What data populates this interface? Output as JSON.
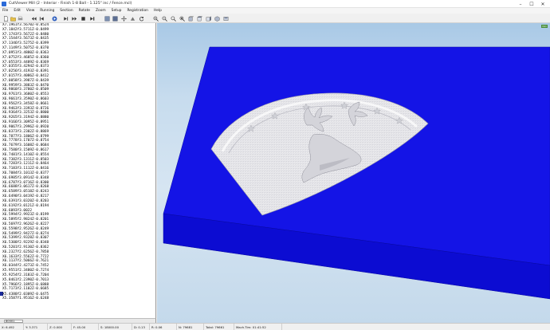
{
  "window": {
    "title": "CutViewer Mill (2 - Interior - Finish 1-8 Ball - 1.125\" inc / Fence.mcl)",
    "controls": {
      "minimize": "–",
      "maximize": "☐",
      "close": "✕"
    }
  },
  "menu": [
    "File",
    "Edit",
    "View",
    "Running",
    "Section",
    "Rotate",
    "Zoom",
    "Setup",
    "Registration",
    "Help"
  ],
  "toolbar": {
    "icons": [
      "new-file-icon",
      "open-folder-icon",
      "print-icon",
      "rewind-icon",
      "step-back-icon",
      "play-icon",
      "step-forward-icon",
      "fast-forward-icon",
      "stop-icon",
      "end-icon",
      "stock-icon",
      "tool-icon",
      "move-icon",
      "section-icon",
      "rotate-icon",
      "zoom-in-icon",
      "zoom-out-icon",
      "zoom-window-icon",
      "zoom-fit-icon",
      "view-front-icon",
      "view-top-icon",
      "view-right-icon",
      "view-iso-icon",
      "settings-icon"
    ]
  },
  "gcode": {
    "lines": [
      "X7.1961Y3.5670Z-0.8524",
      "X7.1842Y3.5711Z-0.8499",
      "X7.1743Y3.5672Z-0.8480",
      "X7.1544Y3.5673Z-0.8435",
      "X7.1346Y3.5275Z-0.8399",
      "X7.1149Y3.5075Z-0.8370",
      "X7.0951Y3.4880Z-0.8363",
      "X7.0752Y3.4685Z-0.8360",
      "X7.0553Y3.4489Z-0.8369",
      "X7.0355Y3.4294Z-0.8373",
      "X7.0256Y3.4193Z-0.8391",
      "X7.0157Y3.4086Z-0.8412",
      "X7.0058Y3.3987Z-0.8439",
      "X6.9959Y3.3883Z-0.8470",
      "X6.9860Y3.3780Z-0.8509",
      "X6.9761Y3.3680Z-0.8553",
      "X6.9661Y3.3590Z-0.8603",
      "X6.9562Y3.3458Z-0.8661",
      "X6.9463Y3.3393Z-0.8726",
      "X6.9364Y3.3253Z-0.8800",
      "X6.9265Y3.3194Z-0.8880",
      "X6.9166Y3.3095Z-0.8951",
      "X6.9067Y3.2996Z-0.8920",
      "X6.8373Y3.2302Z-0.8869",
      "X6.7877Y3.1806Z-0.8799",
      "X6.7778Y3.1707Z-0.8754",
      "X6.7679Y3.1608Z-0.8684",
      "X6.7580Y3.1509Z-0.8617",
      "X6.7481Y3.1410Z-0.8554",
      "X6.7382Y3.1311Z-0.8503",
      "X6.7283Y3.1211Z-0.8464",
      "X6.7183Y3.1112Z-0.8416",
      "X6.7084Y3.1013Z-0.8377",
      "X6.6985Y3.0914Z-0.8348",
      "X6.6787Y3.0716Z-0.8300",
      "X6.6688Y3.0617Z-0.8268",
      "X6.6589Y3.0518Z-0.8243",
      "X6.6490Y3.0419Z-0.8217",
      "X6.6391Y3.0320Z-0.8203",
      "X6.6192Y3.0121Z-0.8194",
      "X6.6093Y3.0022",
      "X6.5994Y2.9923Z-0.8199",
      "X6.5895Y2.9824Z-0.8201",
      "X6.5697Y2.9626Z-0.8227",
      "X6.5598Y2.9526Z-0.8249",
      "X6.5499Y2.9427Z-0.8274",
      "X6.5399Y2.9328Z-0.8307",
      "X6.5300Y2.9229Z-0.8348",
      "X6.5201Y2.9130Z-0.8362",
      "X6.2327Y2.6256Z-0.7858",
      "X6.1633Y2.5562Z-0.7722",
      "X6.1137Y2.5066Z-0.7621",
      "X6.0344Y2.4273Z-0.7452",
      "X5.9551Y2.3480Z-0.7274",
      "X5.9254Y2.3183Z-0.7204",
      "X5.8461Y2.2390Z-0.7013",
      "X5.7966Y2.1895Z-0.6888",
      "X5.7173Y2.1102Z-0.6685",
      "X5.4380Y2.0309Z-0.6475",
      "X5.3587Y1.9516Z-0.6248"
    ],
    "current_line_index": 58
  },
  "line_counter": "80001",
  "statusbar": {
    "x": "X: 6.492",
    "y": "Y: 3.371",
    "z": "Z: 0.000",
    "f": "F: 45.00",
    "s": "S: 18000.00",
    "d": "D: 0.13",
    "r": "R: 0.06",
    "n": "N: 79681",
    "total": "Total: 79661",
    "mach_tim": "Mach.Tim: 01:41:52"
  },
  "viewport_tag": "ISO",
  "colors": {
    "stock_top": "#1414e6",
    "stock_front": "#0c0cd2",
    "stock_side": "#0a0ab8",
    "part": "#e6e6e8",
    "sky_top": "#a9c9e6",
    "sky_bottom": "#c4d9eb"
  }
}
